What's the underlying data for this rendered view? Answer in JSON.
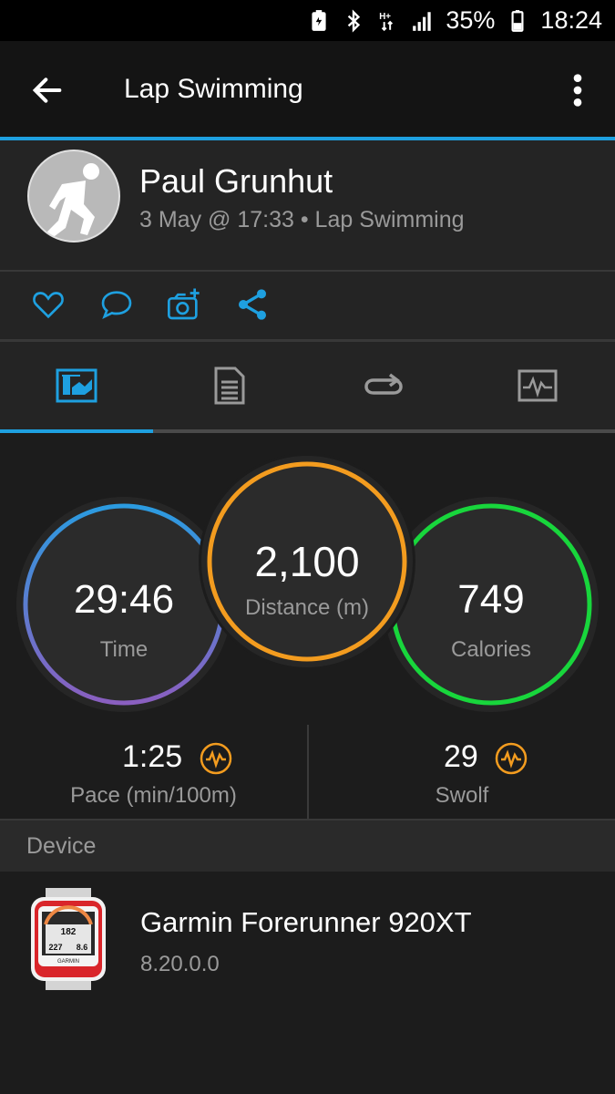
{
  "status_bar": {
    "battery_percent": "35%",
    "time": "18:24",
    "network": "H+",
    "icons": [
      "battery-saver-icon",
      "bluetooth-icon",
      "network-arrows-icon",
      "signal-icon",
      "battery-icon"
    ]
  },
  "app_bar": {
    "title": "Lap Swimming",
    "back_icon": "arrow-back-icon",
    "menu_icon": "more-vert-icon"
  },
  "colors": {
    "accent": "#1ea0e0",
    "time_ring_start": "#2b9be0",
    "time_ring_end": "#8a5fc0",
    "distance_ring": "#f39c1f",
    "calories_ring": "#18d63c",
    "pace_icon": "#f39c1f"
  },
  "activity": {
    "user_name": "Paul Grunhut",
    "meta": "3 May @ 17:33 • Lap Swimming"
  },
  "actions": [
    "like-icon",
    "comment-icon",
    "add-photo-icon",
    "share-icon"
  ],
  "tabs": [
    {
      "icon": "summary-chart-icon",
      "active": true
    },
    {
      "icon": "details-list-icon",
      "active": false
    },
    {
      "icon": "laps-loop-icon",
      "active": false
    },
    {
      "icon": "graph-monitor-icon",
      "active": false
    }
  ],
  "stats": {
    "time": {
      "value": "29:46",
      "label": "Time"
    },
    "distance": {
      "value": "2,100",
      "label": "Distance (m)"
    },
    "calories": {
      "value": "749",
      "label": "Calories"
    }
  },
  "metrics": {
    "pace": {
      "value": "1:25",
      "label": "Pace (min/100m)"
    },
    "swolf": {
      "value": "29",
      "label": "Swolf"
    }
  },
  "device": {
    "section_label": "Device",
    "name": "Garmin Forerunner 920XT",
    "version": "8.20.0.0",
    "watch_readouts": [
      "182",
      "227",
      "8.6"
    ],
    "watch_brand": "GARMIN"
  }
}
